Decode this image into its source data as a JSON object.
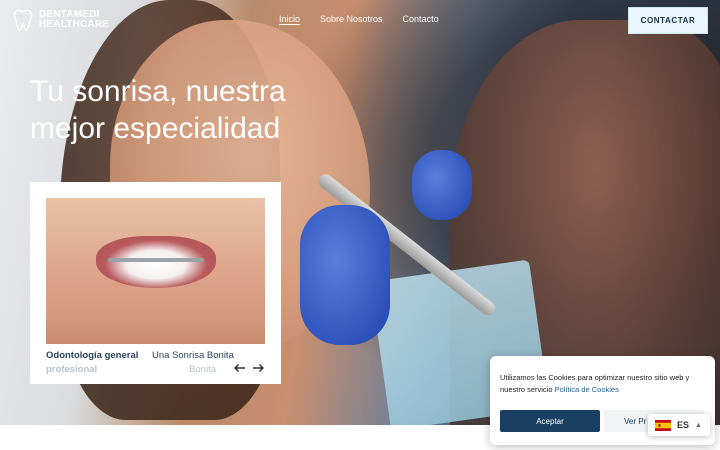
{
  "brand": {
    "name_line1": "DENTAMEDI",
    "name_line2": "HEALTHCARE"
  },
  "nav": {
    "items": [
      {
        "label": "Inicio",
        "active": true
      },
      {
        "label": "Sobre Nosotros",
        "active": false
      },
      {
        "label": "Contacto",
        "active": false
      }
    ]
  },
  "header": {
    "cta_label": "CONTACTAR"
  },
  "hero": {
    "headline_line1": "Tu sonrisa, nuestra",
    "headline_line2": "mejor especialidad"
  },
  "card": {
    "title_line1": "Odontología general",
    "title_line2": "profesional",
    "subtitle_line1": "Una Sonrisa Bonita",
    "subtitle_line2": "Bonita"
  },
  "cookie": {
    "message": "Utilizamos las Cookies para optimizar nuestro sitio web y nuestro servicio",
    "policy_link": "Política de Cookies",
    "accept_label": "Aceptar",
    "prefs_label": "Ver Pr"
  },
  "language": {
    "code": "ES"
  },
  "colors": {
    "brand_dark": "#193f64",
    "accent_text": "#29435a",
    "cta_bg": "#e9f6fb",
    "link": "#1f5d93"
  }
}
